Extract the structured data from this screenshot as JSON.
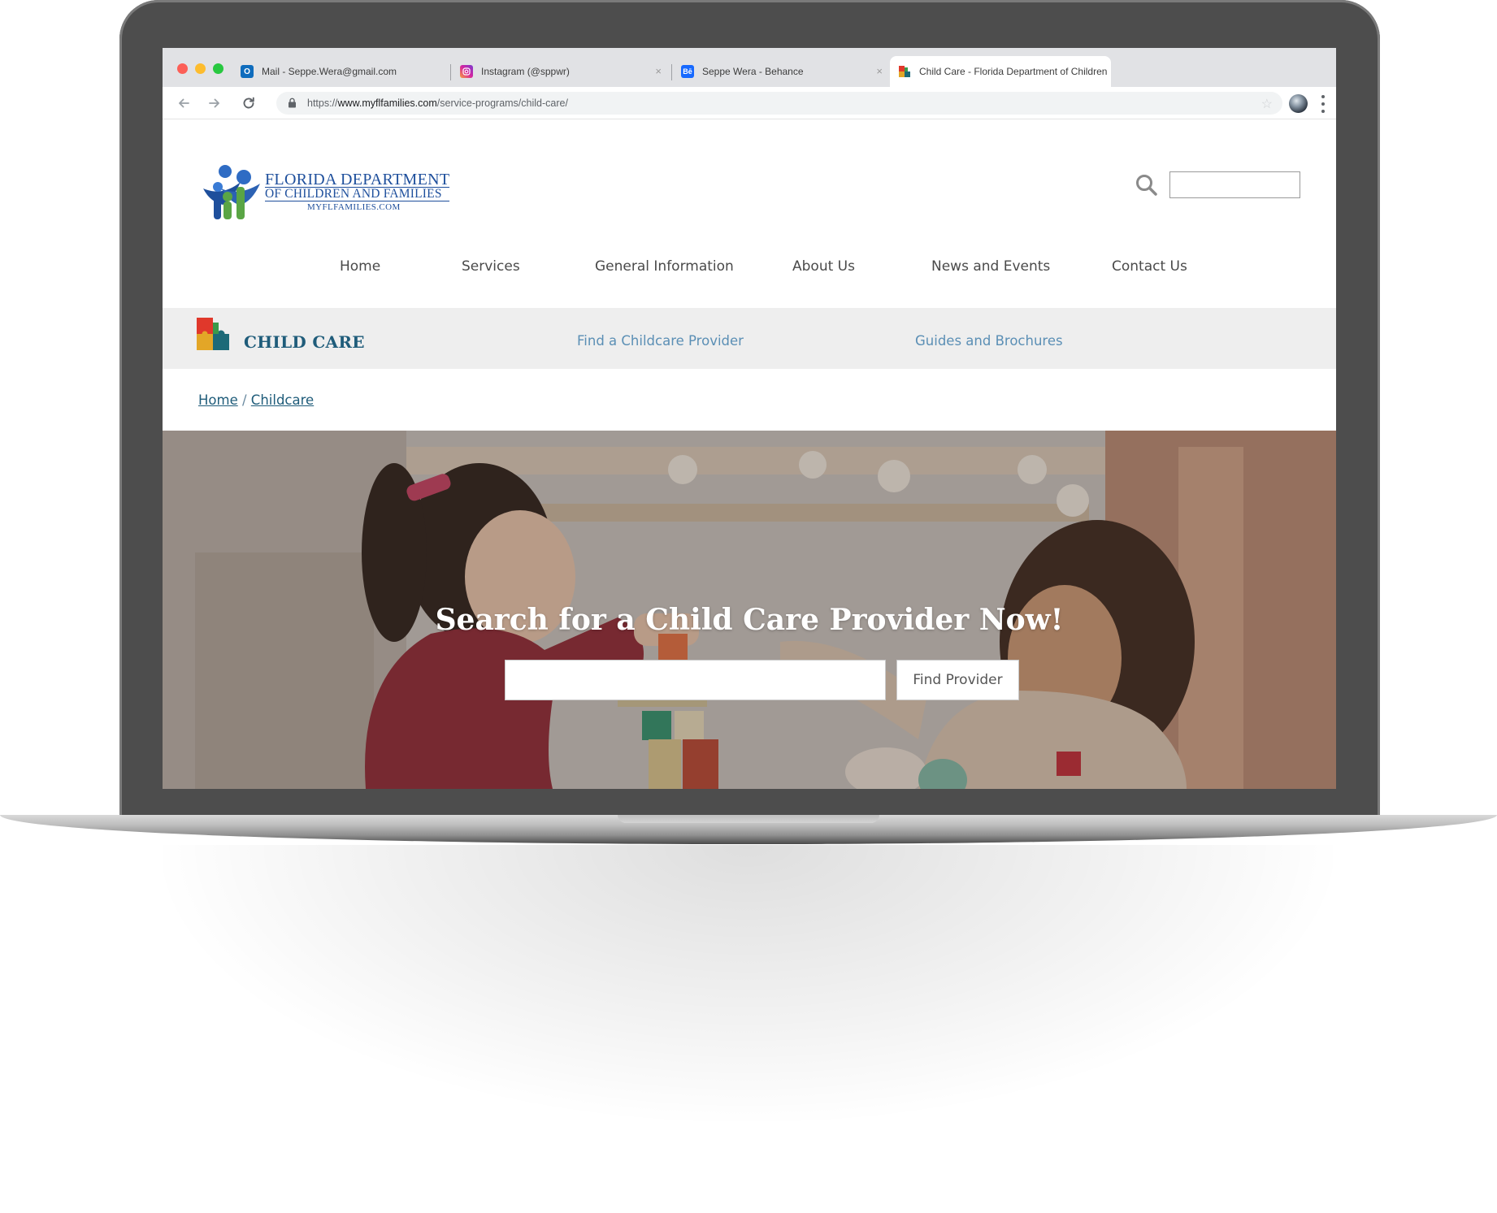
{
  "browser": {
    "tabs": [
      {
        "label": "Mail - Seppe.Wera@gmail.com",
        "icon": "outlook-icon",
        "color": "#0f6cbd"
      },
      {
        "label": "Instagram (@sppwr)",
        "icon": "instagram-icon",
        "color": "#d6249f"
      },
      {
        "label": "Seppe Wera - Behance",
        "icon": "behance-icon",
        "color": "#1769ff"
      },
      {
        "label": "Child Care - Florida Department of Children",
        "icon": "childcare-favicon",
        "color": "#e0382b"
      }
    ],
    "tab_close_glyph": "×",
    "url_scheme": "https://",
    "url_host": "www.myflfamilies.com",
    "url_path": "/service-programs/child-care/"
  },
  "site": {
    "logo": {
      "line1": "FLORIDA DEPARTMENT",
      "line2": "OF CHILDREN AND FAMILIES",
      "line3": "MYFLFAMILIES.COM",
      "color": "#1e4f9c"
    },
    "search_placeholder": "",
    "nav": [
      "Home",
      "Services",
      "General Information",
      "About Us",
      "News and Events",
      "Contact Us"
    ],
    "section": {
      "title": "CHILD CARE",
      "links": [
        "Find a Childcare Provider",
        "Guides and Brochures"
      ]
    },
    "breadcrumb": {
      "items": [
        "Home",
        "Childcare"
      ],
      "separator": "/"
    },
    "hero": {
      "title": "Search for a Child Care Provider Now!",
      "input_placeholder": "",
      "button_label": "Find Provider"
    },
    "colors": {
      "brand_blue": "#1e4f9c",
      "section_title": "#1f5c7a",
      "link": "#5b8fb5",
      "section_bar": "#eeeeee"
    }
  }
}
